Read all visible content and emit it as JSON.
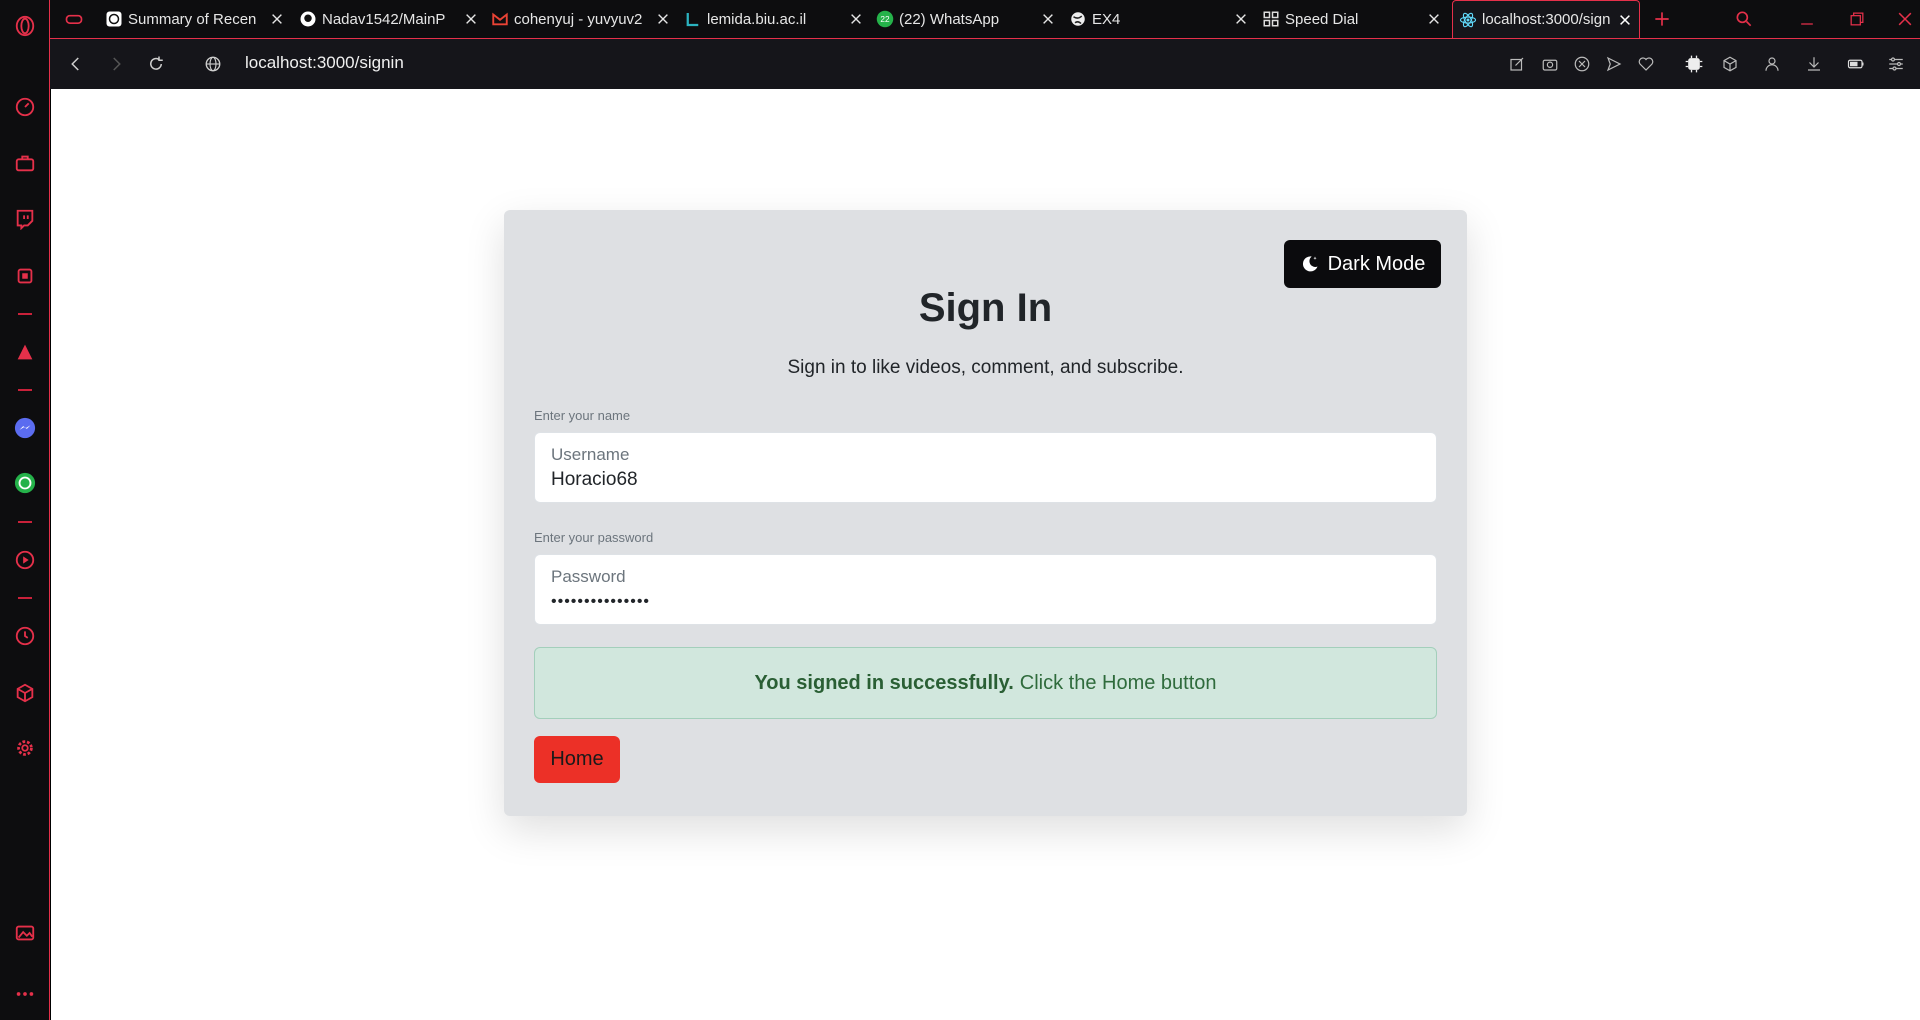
{
  "browser": {
    "tabs": [
      {
        "title": "Summary of Recen",
        "icon": "chatgpt-icon"
      },
      {
        "title": "Nadav1542/MainP",
        "icon": "github-icon"
      },
      {
        "title": "cohenyuj - yuvyuv2",
        "icon": "gmail-icon"
      },
      {
        "title": "lemida.biu.ac.il",
        "icon": "lemida-icon"
      },
      {
        "title": "(22) WhatsApp",
        "icon": "whatsapp-icon",
        "badge": "22"
      },
      {
        "title": "EX4",
        "icon": "globe-icon"
      },
      {
        "title": "Speed Dial",
        "icon": "grid-icon"
      },
      {
        "title": "localhost:3000/sign",
        "icon": "react-icon",
        "active": true
      }
    ],
    "url": "localhost:3000/signin",
    "accent_color": "#e5304a"
  },
  "signin": {
    "dark_mode_label": "Dark Mode",
    "title": "Sign In",
    "subtitle": "Sign in to like videos, comment, and subscribe.",
    "name_hint": "Enter your name",
    "username_label": "Username",
    "username_value": "Horacio68",
    "password_hint": "Enter your password",
    "password_label": "Password",
    "password_value": "•••••••••••••••",
    "success_bold": "You signed in successfully.",
    "success_text": "Click the Home button",
    "home_label": "Home"
  }
}
